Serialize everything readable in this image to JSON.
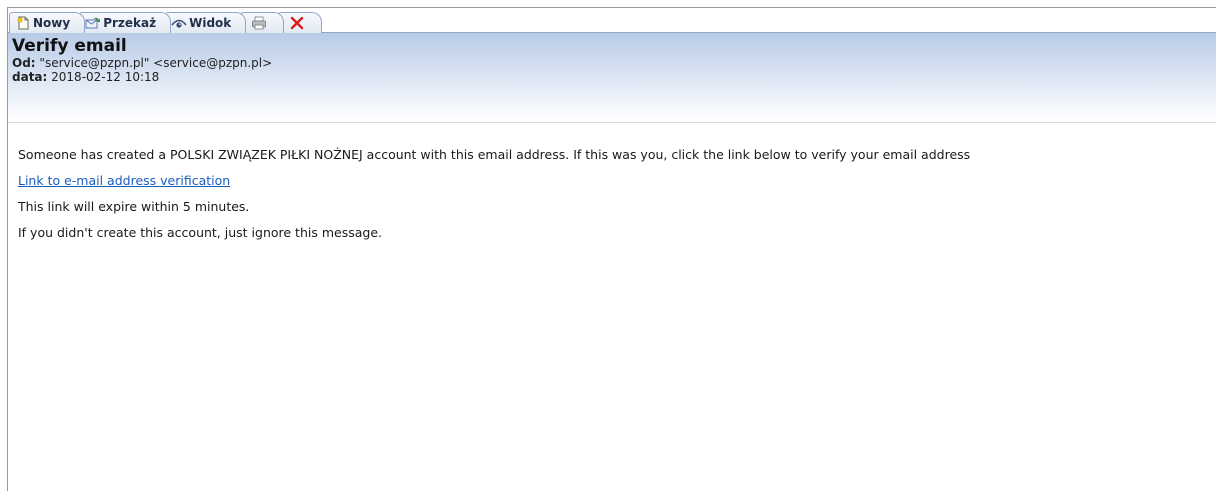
{
  "toolbar": {
    "new_label": "Nowy",
    "forward_label": "Przekaż",
    "view_label": "Widok",
    "icons": {
      "new": "new-document-icon",
      "forward": "forward-icon",
      "view": "eye-icon",
      "print": "printer-icon",
      "delete": "close-x-icon"
    }
  },
  "message": {
    "subject": "Verify email",
    "from_label": "Od:",
    "from_value": "\"service@pzpn.pl\" <service@pzpn.pl>",
    "date_label": "data:",
    "date_value": "2018-02-12 10:18"
  },
  "body": {
    "line1": "Someone has created a POLSKI ZWIĄZEK PIŁKI NOŻNEJ account with this email address. If this was you, click the link below to verify your email address",
    "link_text": "Link to e-mail address verification",
    "line3": "This link will expire within 5 minutes.",
    "line4": "If you didn't create this account, just ignore this message."
  },
  "colors": {
    "link": "#1a5dbd",
    "header_gradient_top": "#b8cbe6",
    "delete_red": "#e01a1a"
  }
}
